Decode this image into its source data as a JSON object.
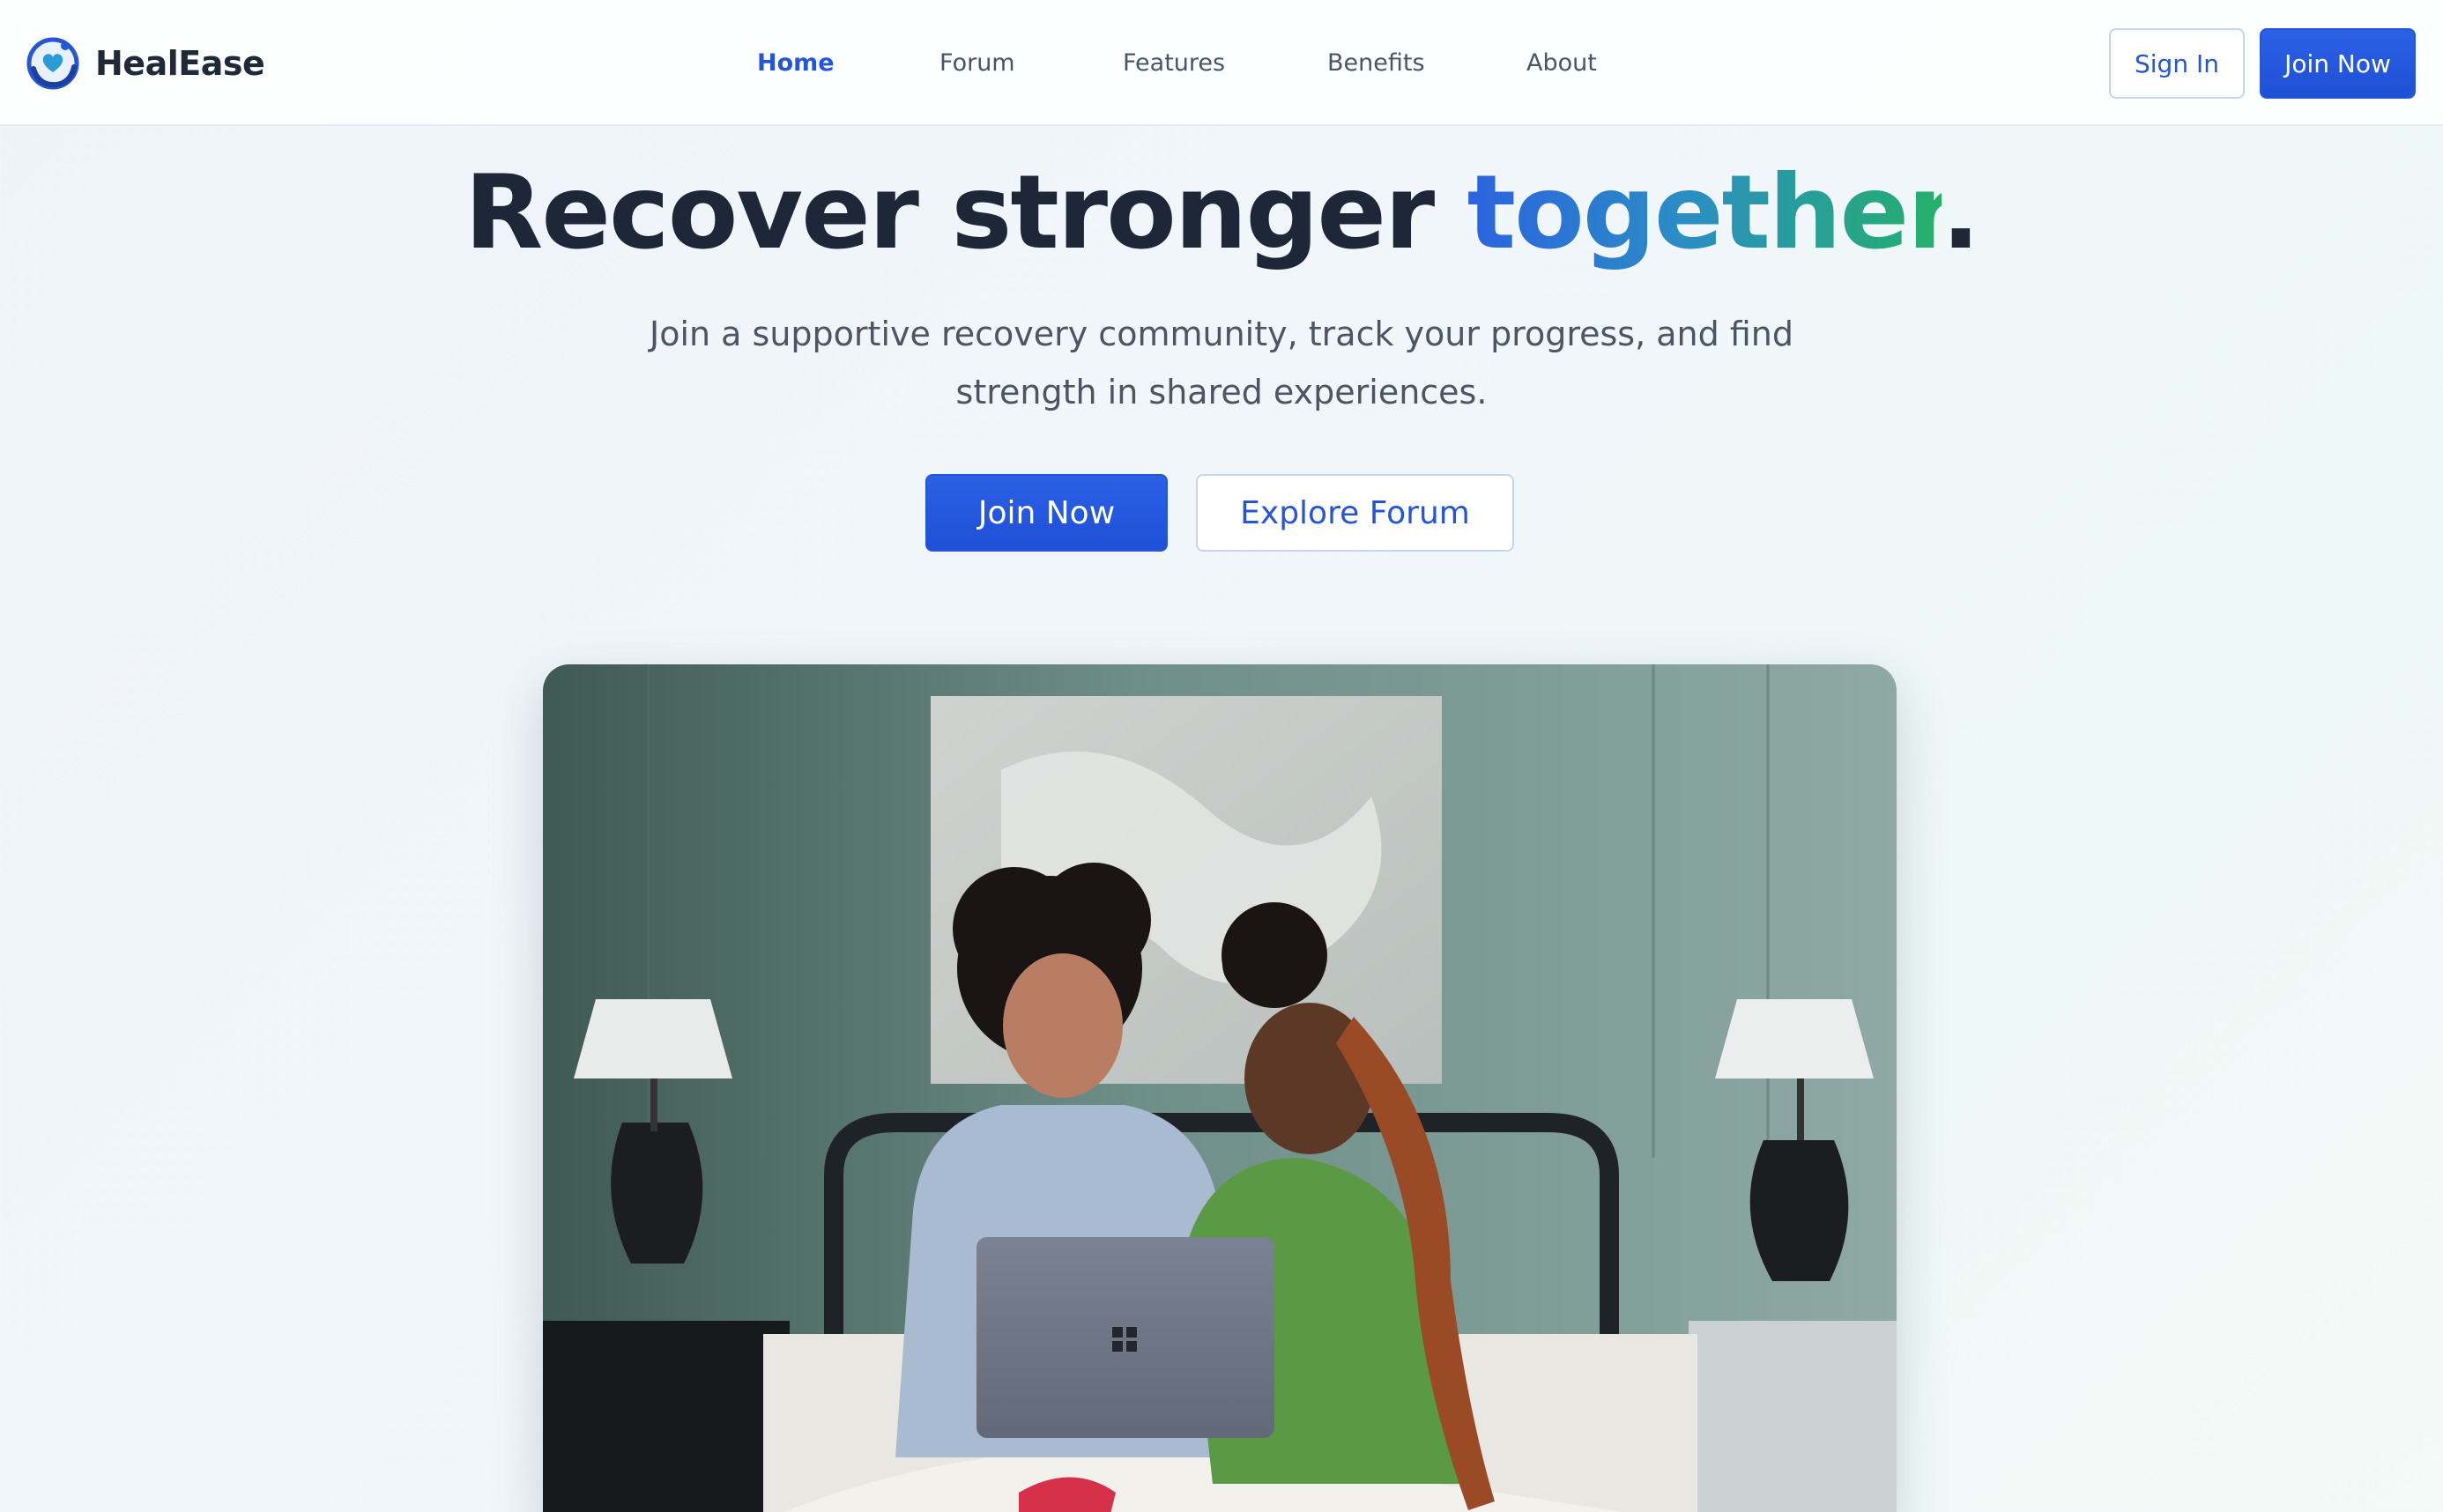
{
  "header": {
    "brand_name": "HealEase",
    "nav": [
      {
        "label": "Home",
        "active": true
      },
      {
        "label": "Forum",
        "active": false
      },
      {
        "label": "Features",
        "active": false
      },
      {
        "label": "Benefits",
        "active": false
      },
      {
        "label": "About",
        "active": false
      }
    ],
    "sign_in_label": "Sign In",
    "join_label": "Join Now"
  },
  "hero": {
    "title_main": "Recover stronger ",
    "title_accent": "together",
    "title_end": ".",
    "subtitle": "Join a supportive recovery community, track your progress, and find strength in shared experiences.",
    "primary_cta": "Join Now",
    "secondary_cta": "Explore Forum",
    "image_icon": "photo-two-women-with-laptop"
  },
  "colors": {
    "accent": "#2556d6",
    "gradient_start": "#2b63e0",
    "gradient_end": "#25b06a",
    "heading": "#1e2738"
  }
}
